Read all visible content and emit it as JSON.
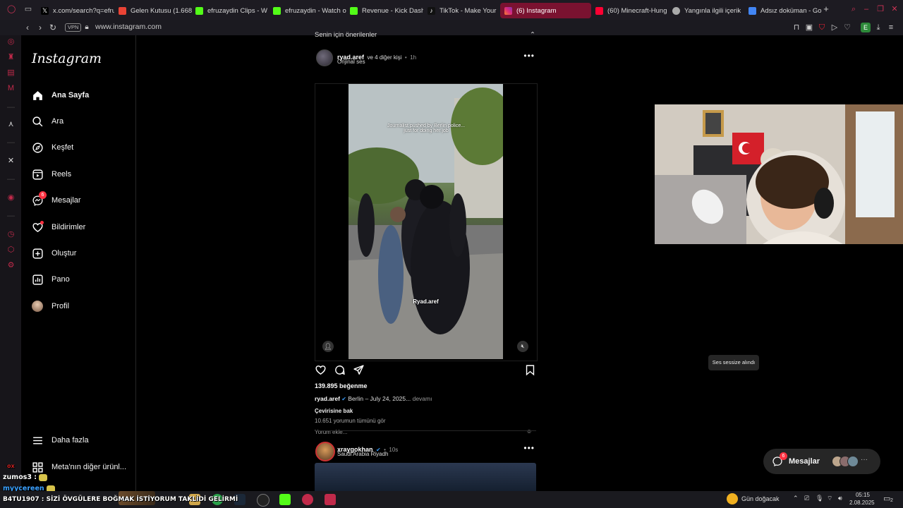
{
  "browser": {
    "tabs": [
      {
        "label": "x.com/search?q=efru"
      },
      {
        "label": "Gelen Kutusu (1.668"
      },
      {
        "label": "efruzaydin Clips - W"
      },
      {
        "label": "efruzaydin - Watch o"
      },
      {
        "label": "Revenue - Kick Dash"
      },
      {
        "label": "TikTok - Make Your"
      },
      {
        "label": "(6) Instagram"
      },
      {
        "label": "(60) Minecraft-Hung"
      },
      {
        "label": "Yangınla ilgili içerik"
      },
      {
        "label": "Adsız doküman - Go"
      }
    ],
    "vpn_label": "VPN",
    "url": "www.instagram.com",
    "profile_letter": "E"
  },
  "nav": {
    "logo": "Instagram",
    "items": [
      {
        "label": "Ana Sayfa",
        "icon": "home-icon"
      },
      {
        "label": "Ara",
        "icon": "search-icon"
      },
      {
        "label": "Keşfet",
        "icon": "compass-icon"
      },
      {
        "label": "Reels",
        "icon": "reels-icon"
      },
      {
        "label": "Mesajlar",
        "icon": "messenger-icon",
        "badge": "6"
      },
      {
        "label": "Bildirimler",
        "icon": "heart-icon"
      },
      {
        "label": "Oluştur",
        "icon": "plus-icon"
      },
      {
        "label": "Pano",
        "icon": "dashboard-icon"
      },
      {
        "label": "Profil",
        "icon": "avatar"
      }
    ],
    "more": "Daha fazla",
    "meta": "Meta'nın diğer ürünl..."
  },
  "feed": {
    "recommended_label": "Senin için önerilenler",
    "post1": {
      "author": "ryad.aref",
      "and_others": "ve 4 diğer kişi",
      "time": "1h",
      "audio": "Orijinal ses",
      "overlay_text": "Journalist pushed by Berlin police... just for doing her job",
      "watermark": "Ryad.aref",
      "likes": "139.895 beğenme",
      "caption_author": "ryad.aref",
      "caption_text": "Berlin – July 24, 2025...",
      "caption_more": "devamı",
      "translate": "Çevirisine bak",
      "comments": "10.651 yorumun tümünü gör",
      "comment_placeholder": "Yorum ekle...",
      "tooltip": "Ses sessize alındı"
    },
    "post2": {
      "author": "xraygokhan",
      "time": "10s",
      "location": "Saudi Arabia Riyadh"
    }
  },
  "messages_pill": {
    "label": "Mesajlar",
    "badge": "6"
  },
  "taskbar": {
    "weather": "Gün doğacak",
    "time": "05:15",
    "date": "2.08.2025",
    "notif_count": "2",
    "ticker": "B4TU1907 : SİZİ ÖVGÜLERE BOĞMAK İSTİYORUM TAKLİDİ GELİRMİ"
  },
  "stream_chat": [
    {
      "user": "zumos3",
      "text": ":"
    },
    {
      "user": "myycereen",
      "text": ""
    }
  ],
  "stream_overlay_tag": "ox",
  "colors": {
    "accent": "#7a1230",
    "instagram_bg": "#000000",
    "badge": "#ff3040",
    "opera_red": "#c02a4a"
  }
}
